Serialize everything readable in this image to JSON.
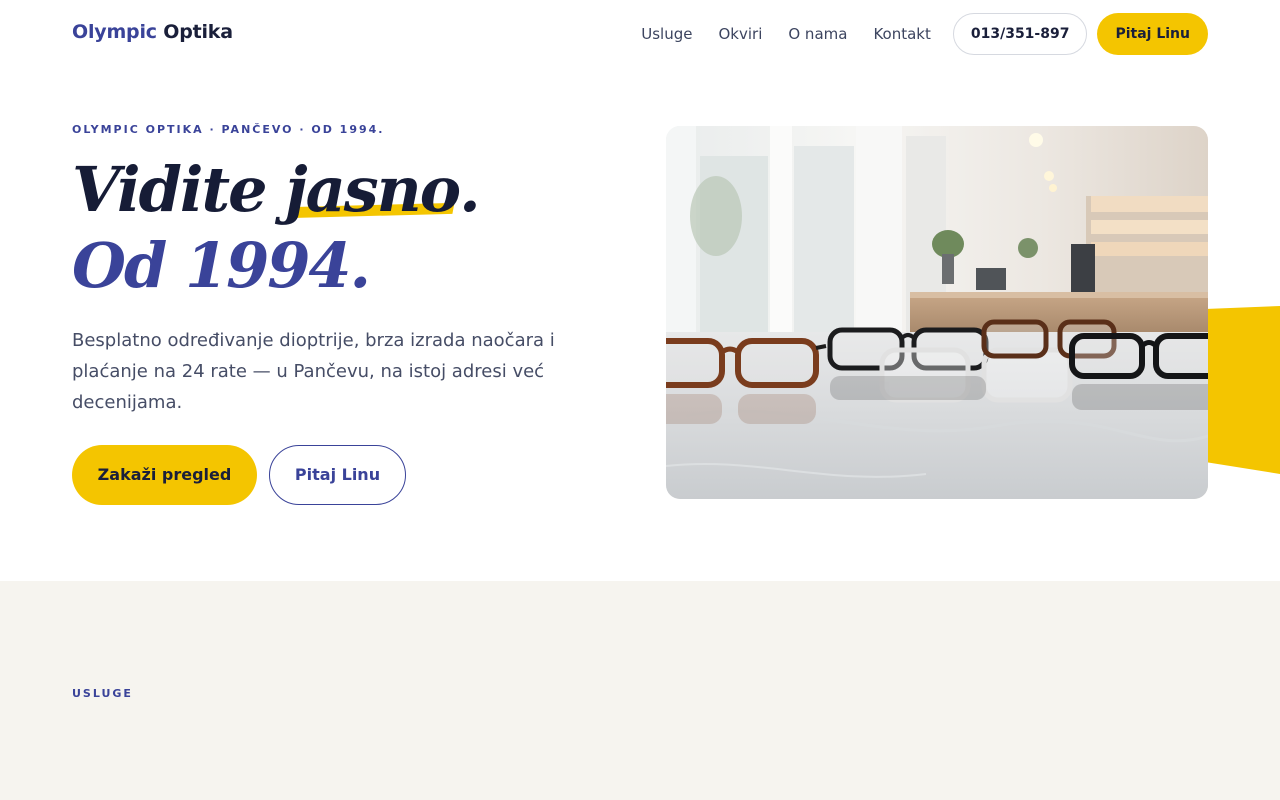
{
  "brand": {
    "name_part1": "Olympic",
    "name_part2": "Optika"
  },
  "nav": {
    "links": [
      "Usluge",
      "Okviri",
      "O nama",
      "Kontakt"
    ],
    "phone": "013/351-897",
    "ask_label": "Pitaj Linu"
  },
  "hero": {
    "eyebrow": "OLYMPIC OPTIKA · PANČEVO · OD 1994.",
    "title_word1": "Vidite",
    "title_highlight": "jasno",
    "title_dot": ".",
    "title_line2": "Od 1994.",
    "lead": "Besplatno određivanje dioptrije, brza izrada naočara i plaćanje na 24 rate — u Pančevu, na istoj adresi već decenijama.",
    "primary_cta": "Zakaži pregled",
    "secondary_cta": "Pitaj Linu"
  },
  "services": {
    "label": "USLUGE"
  },
  "colors": {
    "accent": "#f4c500",
    "brand": "#3a4399",
    "ink": "#161c36",
    "section_bg": "#f6f4ef"
  }
}
